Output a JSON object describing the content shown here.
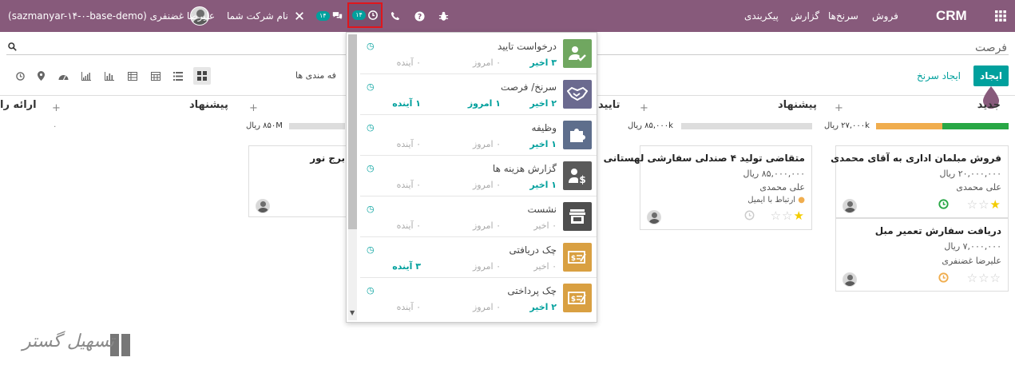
{
  "navbar": {
    "apps_icon": "grid-icon",
    "brand": "CRM",
    "menu": [
      "فروش",
      "سرنخ‌ها",
      "گزارش",
      "پیکربندی"
    ],
    "activity_badge": "۱۴",
    "chat_badge": "۱۴",
    "company": "نام شرکت شما",
    "user": "علیرضا غضنفری (sazmanyar-۱۴-۰-base-demo)"
  },
  "control": {
    "title": "فرصت",
    "create": "ایجاد",
    "create_lead": "ایجاد سرنخ",
    "group_label": "فه مندی ها"
  },
  "columns": [
    {
      "name": "جدید",
      "total": "۲۷,۰۰۰k ریال"
    },
    {
      "name": "پیشنهاد",
      "total": "۸۵,۰۰۰k ریال"
    },
    {
      "name": "تایید",
      "total": ""
    },
    {
      "name": "پیشنهاد",
      "total": "۸۵۰M ریال"
    },
    {
      "name": "ارائه را",
      "total": "۰"
    }
  ],
  "cards": [
    {
      "title": "فروش مبلمان اداری به آقای محمدی",
      "amount": "۲۰,۰۰۰,۰۰۰ ریال",
      "person": "علی محمدی",
      "tag": ""
    },
    {
      "title": "دریافت سفارش تعمیر مبل",
      "amount": "۷,۰۰۰,۰۰۰ ریال",
      "person": "علیرضا غضنفری",
      "tag": ""
    },
    {
      "title": "متقاضی تولید ۴ صندلی سفارشی لهستانی",
      "amount": "۸۵,۰۰۰,۰۰۰ ریال",
      "person": "علی محمدی",
      "tag": "ارتباط با ایمیل"
    },
    {
      "title": "برج نور",
      "amount": "",
      "person": "",
      "tag": ""
    }
  ],
  "activities": [
    {
      "name": "درخواست تایید",
      "late": "۳ اخیر",
      "today": "۰ امروز",
      "future": "۰ آینده",
      "icon": "user-check-icon",
      "color": "#70a760"
    },
    {
      "name": "سرنخ/ فرصت",
      "late": "۲ اخیر",
      "today": "۱ امروز",
      "future": "۱ آینده",
      "icon": "handshake-icon",
      "color": "#6b6a8f"
    },
    {
      "name": "وظیفه",
      "late": "۱ اخیر",
      "today": "۰ امروز",
      "future": "۰ آینده",
      "icon": "puzzle-icon",
      "color": "#5e6e8c"
    },
    {
      "name": "گزارش هزینه ها",
      "late": "۱ اخیر",
      "today": "۰ امروز",
      "future": "۰ آینده",
      "icon": "user-dollar-icon",
      "color": "#5a5a5a"
    },
    {
      "name": "نشست",
      "late": "۰ اخیر",
      "today": "۰ امروز",
      "future": "۰ آینده",
      "icon": "store-icon",
      "color": "#4e4e4e"
    },
    {
      "name": "چک دریافتی",
      "late": "۰ اخیر",
      "today": "۰ امروز",
      "future": "۳ آینده",
      "icon": "check-receive-icon",
      "color": "#d9a042"
    },
    {
      "name": "چک پرداختی",
      "late": "۲ اخیر",
      "today": "۰ امروز",
      "future": "۰ آینده",
      "icon": "check-pay-icon",
      "color": "#d9a042"
    }
  ],
  "watermark": "تسهیل گستر"
}
